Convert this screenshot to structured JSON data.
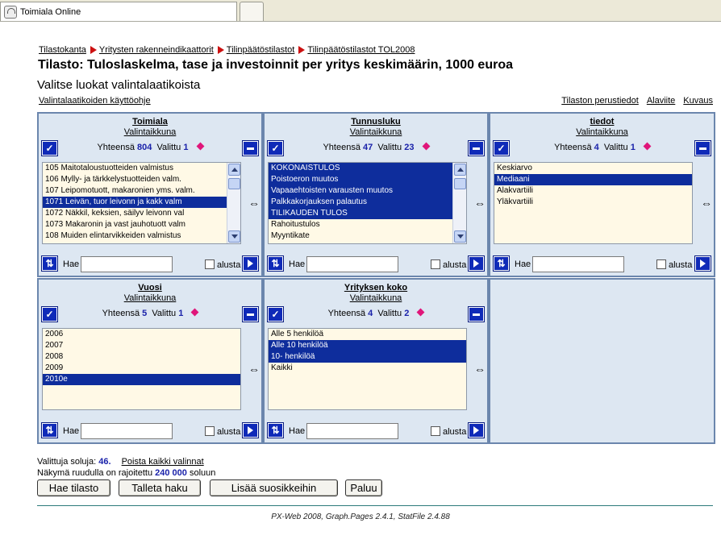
{
  "browser_tab": {
    "title": "Toimiala Online"
  },
  "breadcrumb": [
    "Tilastokanta",
    "Yritysten rakenneindikaattorit",
    "Tilinpäätöstilastot",
    "Tilinpäätöstilastot TOL2008"
  ],
  "page": {
    "title": "Tilasto: Tuloslaskelma, tase ja investoinnit per yritys keskimäärin, 1000 euroa",
    "subtitle": "Valitse luokat valintalaatikoista",
    "help_link": "Valintalaatikoiden käyttöohje",
    "right_links": [
      "Tilaston perustiedot",
      "Alaviite",
      "Kuvaus"
    ]
  },
  "labels": {
    "window_link": "Valintaikkuna",
    "total": "Yhteensä",
    "selected": "Valittu",
    "search": "Hae",
    "from_start": "alusta",
    "swap": "⇔"
  },
  "panels": [
    {
      "title": "Toimiala",
      "total": "804",
      "selected": "1",
      "search_value": "",
      "items": [
        {
          "text": "105 Maitotaloustuotteiden valmistus",
          "selected": false
        },
        {
          "text": "106 Mylly- ja tärkkelystuotteiden valm.",
          "selected": false
        },
        {
          "text": "107 Leipomotuott, makaronien yms. valm.",
          "selected": false
        },
        {
          "text": "1071 Leivän, tuor leivonn ja kakk valm",
          "selected": true
        },
        {
          "text": "1072 Näkkil, keksien, säilyv leivonn val",
          "selected": false
        },
        {
          "text": "1073 Makaronin ja vast jauhotuott valm",
          "selected": false
        },
        {
          "text": "108 Muiden elintarvikkeiden valmistus",
          "selected": false
        }
      ]
    },
    {
      "title": "Tunnusluku",
      "total": "47",
      "selected": "23",
      "search_value": "",
      "items": [
        {
          "text": "KOKONAISTULOS",
          "selected": true
        },
        {
          "text": "Poistoeron muutos",
          "selected": true
        },
        {
          "text": "Vapaaehtoisten varausten muutos",
          "selected": true
        },
        {
          "text": "Palkkakorjauksen palautus",
          "selected": true
        },
        {
          "text": "TILIKAUDEN TULOS",
          "selected": true
        },
        {
          "text": "Rahoitustulos",
          "selected": false
        },
        {
          "text": "Myyntikate",
          "selected": false
        }
      ]
    },
    {
      "title": "tiedot",
      "total": "4",
      "selected": "1",
      "search_value": "",
      "items": [
        {
          "text": "Keskiarvo",
          "selected": false
        },
        {
          "text": "Mediaani",
          "selected": true
        },
        {
          "text": "Alakvartiili",
          "selected": false
        },
        {
          "text": "Yläkvartiili",
          "selected": false
        }
      ]
    },
    {
      "title": "Vuosi",
      "total": "5",
      "selected": "1",
      "search_value": "",
      "items": [
        {
          "text": "2006",
          "selected": false
        },
        {
          "text": "2007",
          "selected": false
        },
        {
          "text": "2008",
          "selected": false
        },
        {
          "text": "2009",
          "selected": false
        },
        {
          "text": "2010e",
          "selected": true
        }
      ]
    },
    {
      "title": "Yrityksen koko",
      "total": "4",
      "selected": "2",
      "search_value": "",
      "items": [
        {
          "text": "Alle 5 henkilöä",
          "selected": false
        },
        {
          "text": "Alle 10 henkilöä",
          "selected": true
        },
        {
          "text": "10- henkilöä",
          "selected": true
        },
        {
          "text": "Kaikki",
          "selected": false
        }
      ]
    }
  ],
  "summary": {
    "cells_label": "Valittuja soluja:",
    "cells_value": "46.",
    "clear_all": "Poista kaikki valinnat",
    "limit_label": "Näkymä ruudulla on rajoitettu",
    "limit_value": "240 000",
    "limit_unit": "soluun"
  },
  "actions": [
    "Hae tilasto",
    "Talleta haku",
    "Lisää suosikkeihin",
    "Paluu"
  ],
  "footer": "PX-Web 2008, Graph.Pages 2.4.1, StatFile 2.4.88"
}
